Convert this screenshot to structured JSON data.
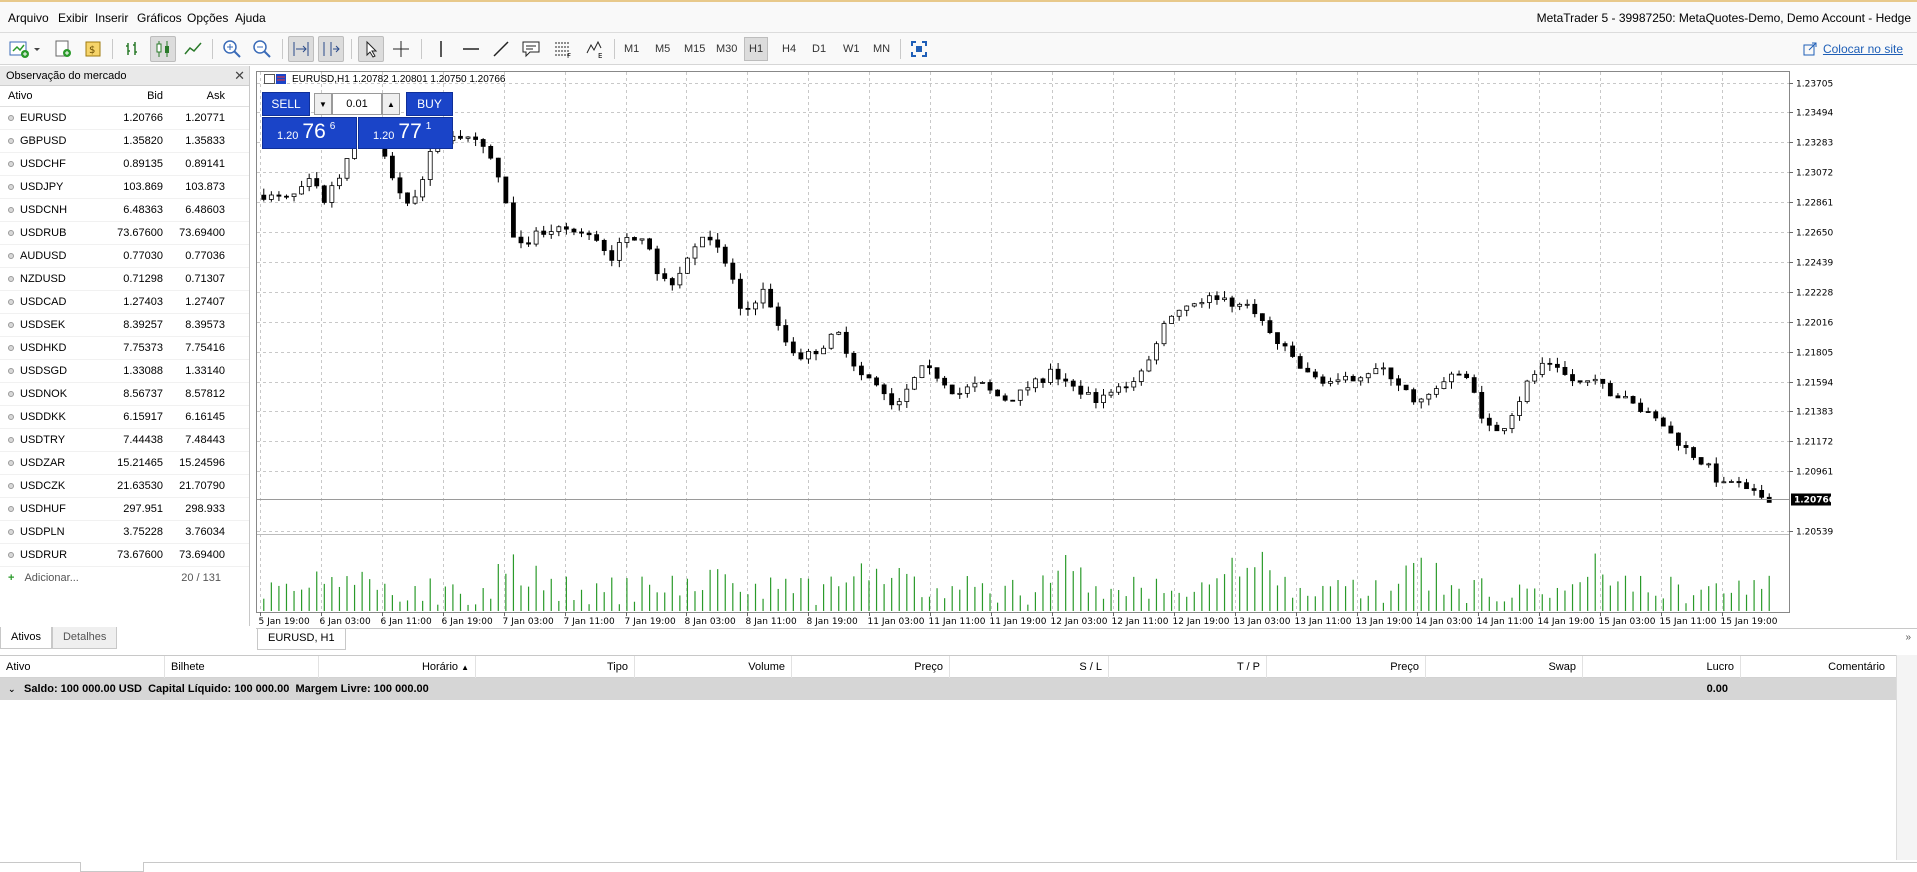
{
  "menu": [
    "Arquivo",
    "Exibir",
    "Inserir",
    "Gráficos",
    "Opções",
    "Ajuda"
  ],
  "window_title": "MetaTrader 5 - 39987250: MetaQuotes-Demo, Demo Account - Hedge",
  "toolbar": {
    "timeframes": [
      "M1",
      "M5",
      "M15",
      "M30",
      "H1",
      "H4",
      "D1",
      "W1",
      "MN"
    ],
    "active_timeframe": "H1",
    "colocar_label": "Colocar no site"
  },
  "market_watch": {
    "title": "Observação do mercado",
    "columns": [
      "Ativo",
      "Bid",
      "Ask"
    ],
    "rows": [
      {
        "symbol": "EURUSD",
        "bid": "1.20766",
        "ask": "1.20771"
      },
      {
        "symbol": "GBPUSD",
        "bid": "1.35820",
        "ask": "1.35833"
      },
      {
        "symbol": "USDCHF",
        "bid": "0.89135",
        "ask": "0.89141"
      },
      {
        "symbol": "USDJPY",
        "bid": "103.869",
        "ask": "103.873"
      },
      {
        "symbol": "USDCNH",
        "bid": "6.48363",
        "ask": "6.48603"
      },
      {
        "symbol": "USDRUB",
        "bid": "73.67600",
        "ask": "73.69400"
      },
      {
        "symbol": "AUDUSD",
        "bid": "0.77030",
        "ask": "0.77036"
      },
      {
        "symbol": "NZDUSD",
        "bid": "0.71298",
        "ask": "0.71307"
      },
      {
        "symbol": "USDCAD",
        "bid": "1.27403",
        "ask": "1.27407"
      },
      {
        "symbol": "USDSEK",
        "bid": "8.39257",
        "ask": "8.39573"
      },
      {
        "symbol": "USDHKD",
        "bid": "7.75373",
        "ask": "7.75416"
      },
      {
        "symbol": "USDSGD",
        "bid": "1.33088",
        "ask": "1.33140"
      },
      {
        "symbol": "USDNOK",
        "bid": "8.56737",
        "ask": "8.57812"
      },
      {
        "symbol": "USDDKK",
        "bid": "6.15917",
        "ask": "6.16145"
      },
      {
        "symbol": "USDTRY",
        "bid": "7.44438",
        "ask": "7.48443"
      },
      {
        "symbol": "USDZAR",
        "bid": "15.21465",
        "ask": "15.24596"
      },
      {
        "symbol": "USDCZK",
        "bid": "21.63530",
        "ask": "21.70790"
      },
      {
        "symbol": "USDHUF",
        "bid": "297.951",
        "ask": "298.933"
      },
      {
        "symbol": "USDPLN",
        "bid": "3.75228",
        "ask": "3.76034"
      },
      {
        "symbol": "USDRUR",
        "bid": "73.67600",
        "ask": "73.69400"
      }
    ],
    "add_label": "Adicionar...",
    "count": "20 / 131",
    "tabs": [
      "Ativos",
      "Detalhes"
    ]
  },
  "chart": {
    "header": "EURUSD,H1  1.20782 1.20801 1.20750 1.20766",
    "tab_label": "EURUSD, H1",
    "trade": {
      "sell_label": "SELL",
      "buy_label": "BUY",
      "lot": "0.01",
      "sell_small": "1.20",
      "sell_big": "76",
      "sell_sup": "6",
      "buy_small": "1.20",
      "buy_big": "77",
      "buy_sup": "1"
    },
    "current_price": "1.20766"
  },
  "chart_data": {
    "type": "candlestick",
    "symbol": "EURUSD",
    "timeframe": "H1",
    "y_ticks": [
      "1.23705",
      "1.23494",
      "1.23283",
      "1.23072",
      "1.22861",
      "1.22650",
      "1.22439",
      "1.22228",
      "1.22016",
      "1.21805",
      "1.21594",
      "1.21383",
      "1.21172",
      "1.20961",
      "1.20539"
    ],
    "ylim": [
      1.20539,
      1.23705
    ],
    "x_ticks": [
      "5 Jan 19:00",
      "6 Jan 03:00",
      "6 Jan 11:00",
      "6 Jan 19:00",
      "7 Jan 03:00",
      "7 Jan 11:00",
      "7 Jan 19:00",
      "8 Jan 03:00",
      "8 Jan 11:00",
      "8 Jan 19:00",
      "11 Jan 03:00",
      "11 Jan 11:00",
      "11 Jan 19:00",
      "12 Jan 03:00",
      "12 Jan 11:00",
      "12 Jan 19:00",
      "13 Jan 03:00",
      "13 Jan 11:00",
      "13 Jan 19:00",
      "14 Jan 03:00",
      "14 Jan 11:00",
      "14 Jan 19:00",
      "15 Jan 03:00",
      "15 Jan 11:00",
      "15 Jan 19:00"
    ],
    "close_path": [
      1.2291,
      1.2289,
      1.2288,
      1.2293,
      1.2302,
      1.2286,
      1.2299,
      1.2315,
      1.2331,
      1.2338,
      1.232,
      1.23,
      1.2283,
      1.2297,
      1.2321,
      1.233,
      1.2335,
      1.233,
      1.2327,
      1.2316,
      1.2296,
      1.2256,
      1.2253,
      1.2266,
      1.2262,
      1.2268,
      1.2265,
      1.2262,
      1.226,
      1.2246,
      1.2258,
      1.2262,
      1.2263,
      1.2235,
      1.2228,
      1.224,
      1.2253,
      1.2266,
      1.2252,
      1.2239,
      1.2205,
      1.2216,
      1.2225,
      1.2198,
      1.2183,
      1.2177,
      1.218,
      1.2186,
      1.2195,
      1.2178,
      1.2164,
      1.216,
      1.2148,
      1.214,
      1.2155,
      1.2168,
      1.2166,
      1.2159,
      1.215,
      1.2155,
      1.2158,
      1.2151,
      1.2147,
      1.2149,
      1.2156,
      1.216,
      1.2167,
      1.2158,
      1.2154,
      1.215,
      1.2146,
      1.2152,
      1.2156,
      1.2162,
      1.2172,
      1.2195,
      1.2208,
      1.2212,
      1.2216,
      1.2218,
      1.222,
      1.2215,
      1.2213,
      1.221,
      1.2195,
      1.2185,
      1.2178,
      1.2166,
      1.2162,
      1.216,
      1.2158,
      1.2162,
      1.2165,
      1.2168,
      1.2166,
      1.2158,
      1.2148,
      1.2146,
      1.2152,
      1.2161,
      1.2165,
      1.2158,
      1.2135,
      1.2122,
      1.213,
      1.2145,
      1.2162,
      1.217,
      1.2168,
      1.2163,
      1.2158,
      1.216,
      1.2156,
      1.215,
      1.2147,
      1.2141,
      1.2135,
      1.213,
      1.212,
      1.2112,
      1.2105,
      1.2098,
      1.2085,
      1.209,
      1.2082,
      1.2079,
      1.2077
    ]
  },
  "toolbox": {
    "columns": [
      "Ativo",
      "Bilhete",
      "Horário",
      "Tipo",
      "Volume",
      "Preço",
      "S / L",
      "T / P",
      "Preço",
      "Swap",
      "Lucro",
      "Comentário"
    ],
    "balance_text": "Saldo: 100 000.00 USD  Capital Líquido: 100 000.00  Margem Livre: 100 000.00",
    "profit": "0.00"
  }
}
